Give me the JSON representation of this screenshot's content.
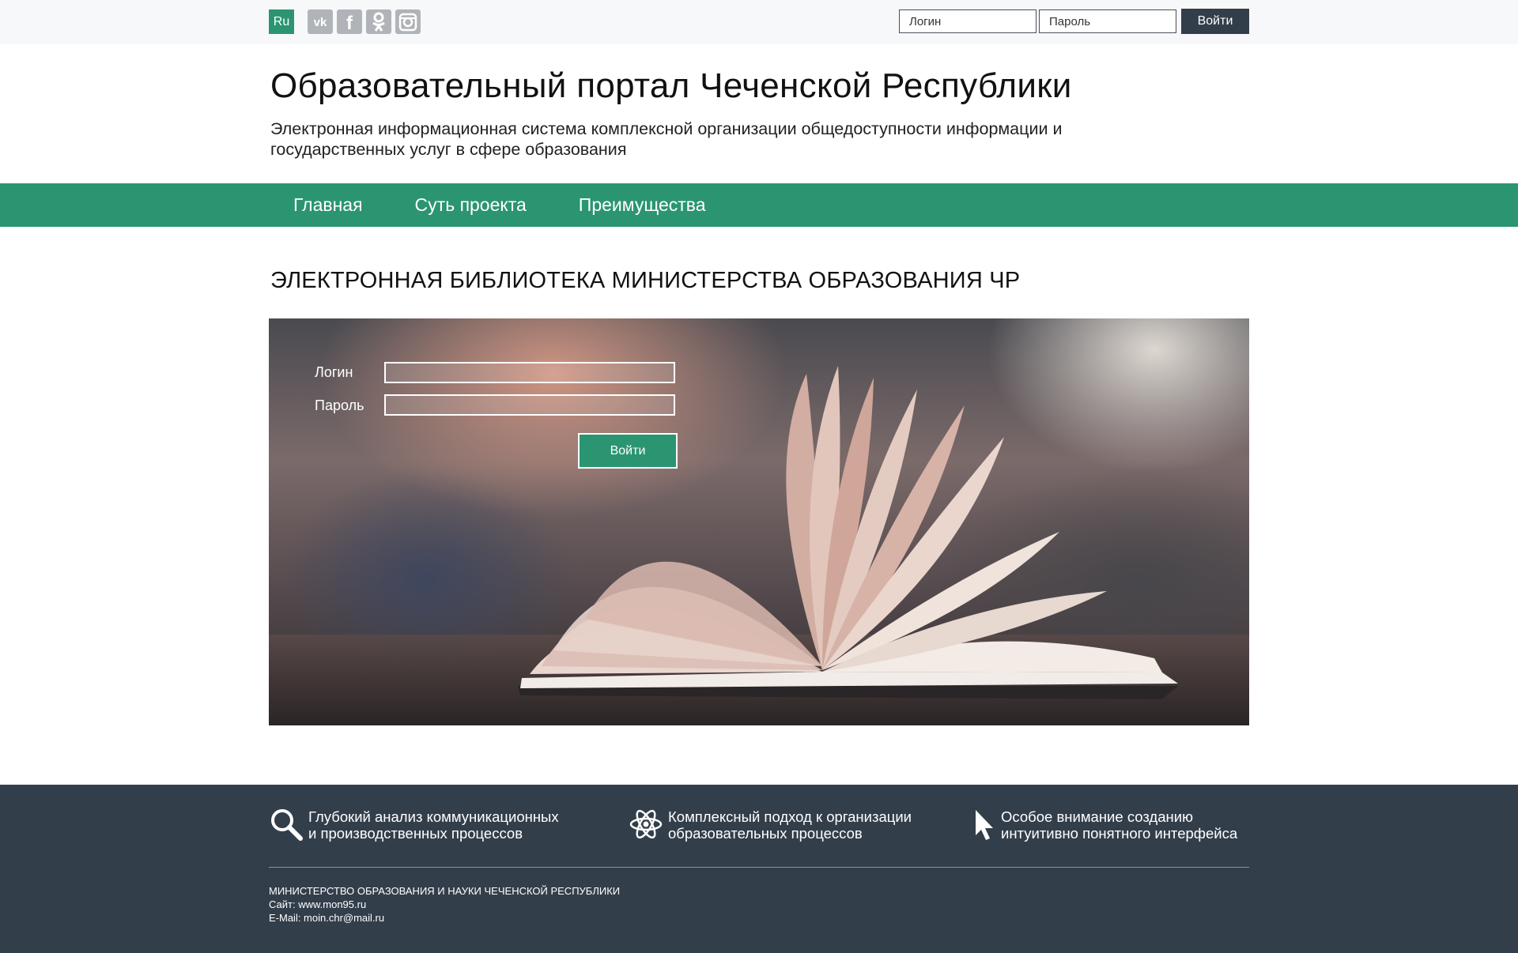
{
  "topbar": {
    "lang_label": "Ru",
    "socials": [
      {
        "icon": "vk-icon",
        "glyph": "vk"
      },
      {
        "icon": "facebook-icon",
        "glyph": "f"
      },
      {
        "icon": "odnoklassniki-icon",
        "glyph": "ok"
      },
      {
        "icon": "instagram-icon",
        "glyph": "ig"
      }
    ],
    "login_placeholder": "Логин",
    "password_placeholder": "Пароль",
    "submit_label": "Войти"
  },
  "header": {
    "title": "Образовательный портал Чеченской Республики",
    "subtitle": "Электронная информационная система комплексной организации общедоступности информации и государственных услуг в сфере образования"
  },
  "nav": {
    "items": [
      {
        "label": "Главная"
      },
      {
        "label": "Суть проекта"
      },
      {
        "label": "Преимущества"
      }
    ]
  },
  "main": {
    "section_title": "ЭЛЕКТРОННАЯ БИБЛИОТЕКА МИНИСТЕРСТВА ОБРАЗОВАНИЯ ЧР",
    "form": {
      "login_label": "Логин",
      "password_label": "Пароль",
      "login_value": "",
      "password_value": "",
      "submit_label": "Войти"
    }
  },
  "footer": {
    "features": [
      {
        "icon": "magnifier-icon",
        "text": "Глубокий анализ коммуникационных\nи производственных процессов"
      },
      {
        "icon": "atom-icon",
        "text": "Комплексный подход к организации\nобразовательных процессов"
      },
      {
        "icon": "cursor-icon",
        "text": "Особое внимание созданию\nинтуитивно понятного интерфейса"
      }
    ],
    "org": "МИНИСТЕРСТВО ОБРАЗОВАНИЯ И НАУКИ ЧЕЧЕНСКОЙ РЕСПУБЛИКИ",
    "site": "Сайт: www.mon95.ru",
    "email": "E-Mail: moin.chr@mail.ru"
  },
  "colors": {
    "brand_green": "#2b9572",
    "dark": "#333e4b",
    "topbar_bg": "#f7f8fa"
  }
}
